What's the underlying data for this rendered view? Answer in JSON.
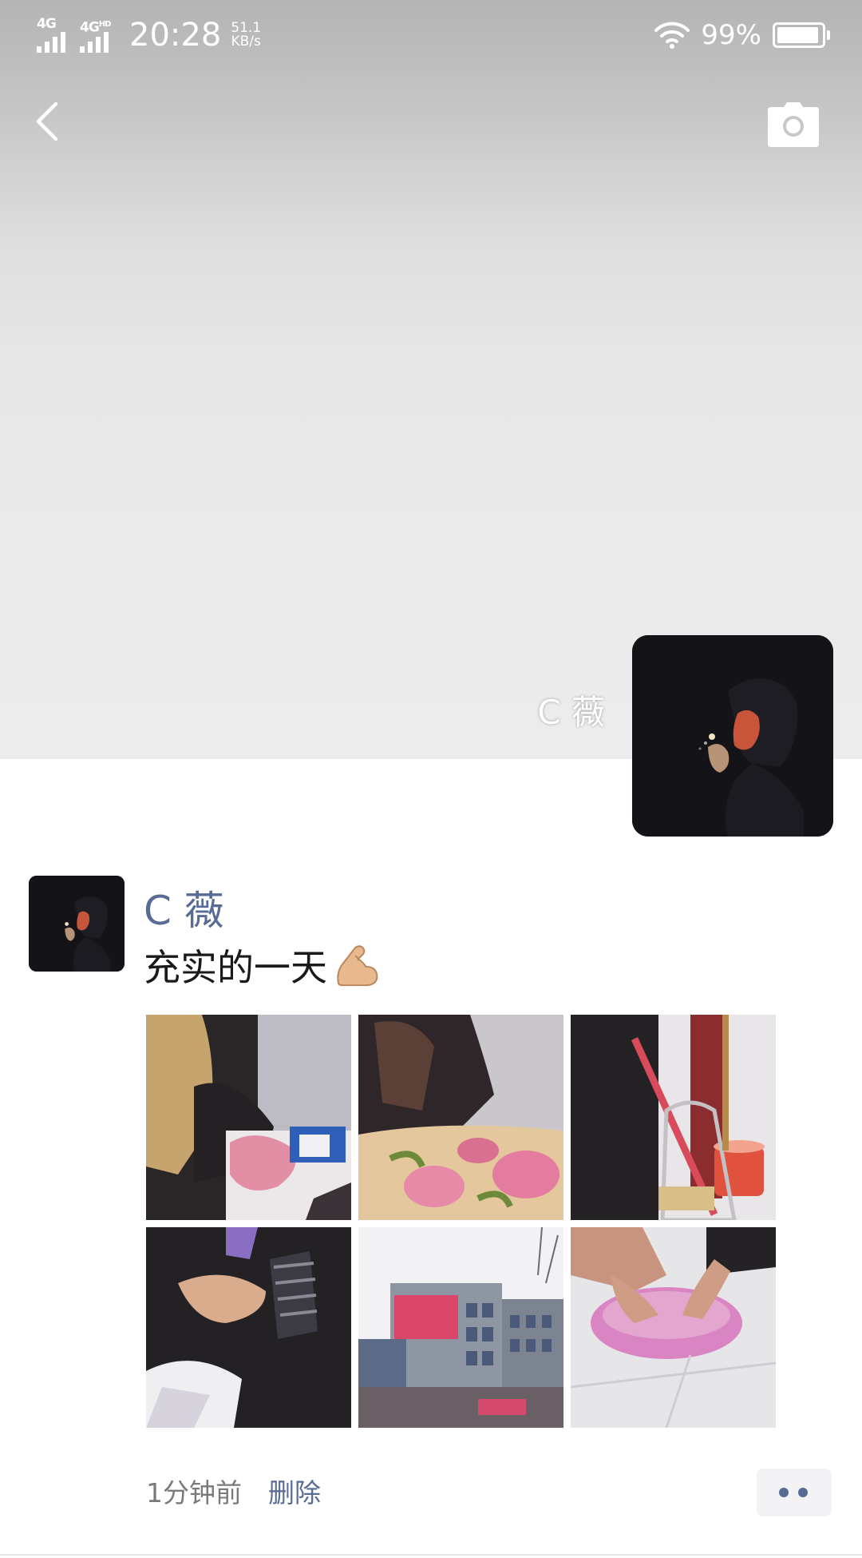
{
  "status_bar": {
    "network_1": "4G",
    "network_2": "4G",
    "network_2_sup": "HD",
    "time": "20:28",
    "speed_value": "51.1",
    "speed_unit": "KB/s",
    "battery_percent": "99%",
    "icons": [
      "signal-icon",
      "wifi-icon",
      "battery-icon"
    ]
  },
  "nav": {
    "back_icon": "chevron-left-icon",
    "camera_icon": "camera-icon"
  },
  "profile": {
    "name": "C 薇"
  },
  "post": {
    "author": "C 薇",
    "text": "充实的一天",
    "emoji": "muscle-emoji",
    "time_ago": "1分钟前",
    "delete_label": "删除",
    "more_icon": "more-dots-icon",
    "images": [
      {
        "name": "photo-1",
        "desc_icon": "photo"
      },
      {
        "name": "photo-2",
        "desc_icon": "photo"
      },
      {
        "name": "photo-3",
        "desc_icon": "photo"
      },
      {
        "name": "photo-4",
        "desc_icon": "photo"
      },
      {
        "name": "photo-5",
        "desc_icon": "photo"
      },
      {
        "name": "photo-6",
        "desc_icon": "photo"
      }
    ]
  },
  "colors": {
    "link_blue": "#576b95",
    "cover_bg": "#ececec",
    "more_btn_bg": "#f3f3f5"
  }
}
